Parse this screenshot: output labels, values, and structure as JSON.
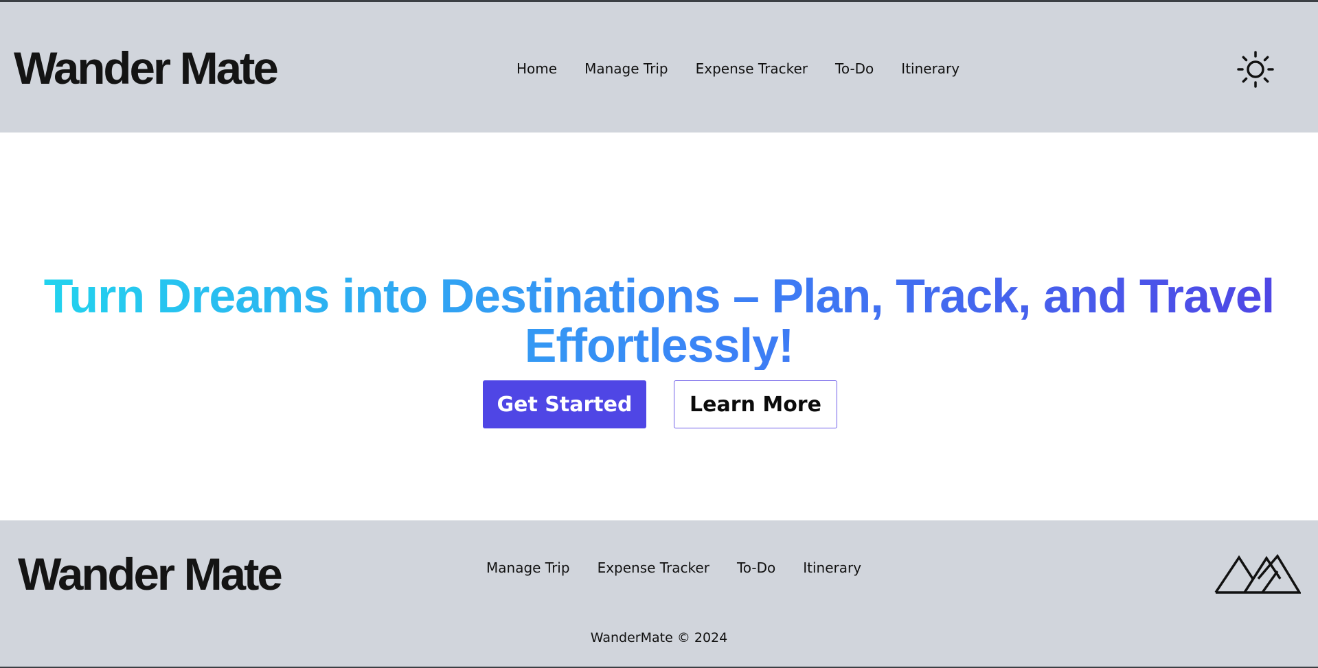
{
  "header": {
    "logo": "Wander Mate",
    "nav": [
      "Home",
      "Manage Trip",
      "Expense Tracker",
      "To-Do",
      "Itinerary"
    ],
    "theme_icon": "sun-icon"
  },
  "hero": {
    "headline": "Turn Dreams into Destinations – Plan, Track, and Travel Effortlessly!",
    "primary_button": "Get Started",
    "secondary_button": "Learn More"
  },
  "footer": {
    "logo": "Wander Mate",
    "nav": [
      "Manage Trip",
      "Expense Tracker",
      "To-Do",
      "Itinerary"
    ],
    "logo_mark_icon": "mountains-icon",
    "copyright": "WanderMate © 2024"
  },
  "colors": {
    "bar_background": "#d1d5dc",
    "primary": "#4f46e5",
    "gradient_start": "#22d3ee",
    "gradient_mid": "#3b82f6",
    "gradient_end": "#4f46e5"
  }
}
